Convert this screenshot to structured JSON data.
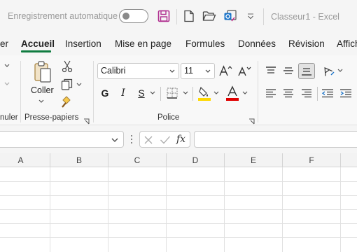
{
  "titlebar": {
    "autosave_label": "Enregistrement automatique",
    "doc_title": "Classeur1  -  Excel",
    "icons": [
      "toggle-switch",
      "save-icon",
      "new-file-icon",
      "open-folder-icon",
      "outlook-icon",
      "customize-toolbar-icon"
    ]
  },
  "tabs": {
    "items": [
      {
        "label": "er"
      },
      {
        "label": "Accueil"
      },
      {
        "label": "Insertion"
      },
      {
        "label": "Mise en page"
      },
      {
        "label": "Formules"
      },
      {
        "label": "Données"
      },
      {
        "label": "Révision"
      },
      {
        "label": "Affich"
      }
    ],
    "active": "Accueil"
  },
  "ribbon": {
    "groups": {
      "undo": "nuler",
      "clipboard": "Presse-papiers",
      "font": "Police"
    },
    "clipboard": {
      "paste_label": "Coller"
    },
    "font": {
      "family": "Calibri",
      "size": "11",
      "bold": "G",
      "italic": "I",
      "underline": "S"
    }
  },
  "formula_bar": {
    "fx_label": "fx",
    "value": ""
  },
  "grid": {
    "columns": [
      "A",
      "B",
      "C",
      "D",
      "E",
      "F"
    ]
  },
  "colors": {
    "accent": "#107c41",
    "save_icon": "#b02e8f",
    "highlight": "#ffd800",
    "font_color": "#e00000"
  }
}
